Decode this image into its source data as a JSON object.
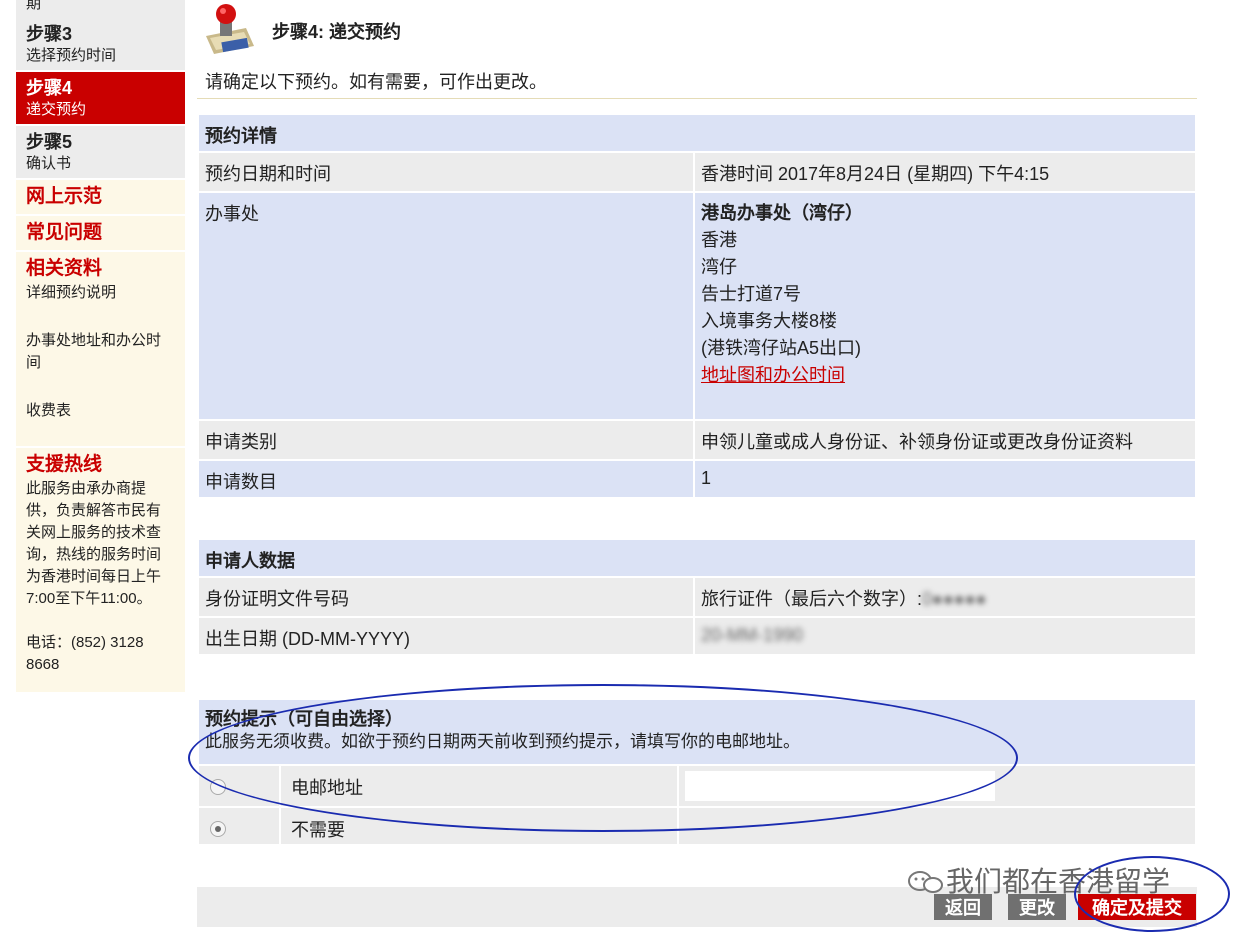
{
  "sidebar": {
    "top_fragment": "期",
    "steps": [
      {
        "title": "步骤3",
        "sub": "选择预约时间"
      },
      {
        "title": "步骤4",
        "sub": "递交预约"
      },
      {
        "title": "步骤5",
        "sub": "确认书"
      }
    ],
    "links": [
      {
        "title": "网上示范"
      },
      {
        "title": "常见问题"
      }
    ],
    "related": {
      "title": "相关资料",
      "items": [
        "详细预约说明",
        "办事处地址和办公时间",
        "收费表"
      ]
    },
    "hotline": {
      "title": "支援热线",
      "desc": "此服务由承办商提供，负责解答市民有关网上服务的技术查询，热线的服务时间为香港时间每日上午7:00至下午11:00。",
      "phone": "电话：(852) 3128 8668"
    }
  },
  "header": {
    "title": "步骤4: 递交预约",
    "intro": "请确定以下预约。如有需要，可作出更改。"
  },
  "details": {
    "heading": "预约详情",
    "datetime_label": "预约日期和时间",
    "datetime_value": "香港时间 2017年8月24日 (星期四) 下午4:15",
    "office_label": "办事处",
    "office_lines": [
      "港岛办事处（湾仔）",
      "香港",
      "湾仔",
      "告士打道7号",
      "入境事务大楼8楼",
      "(港铁湾仔站A5出口)"
    ],
    "map_link": "地址图和办公时间",
    "type_label": "申请类别",
    "type_value": "申领儿童或成人身份证、补领身份证或更改身份证资料",
    "count_label": "申请数目",
    "count_value": "1"
  },
  "applicant": {
    "heading": "申请人数据",
    "id_label": "身份证明文件号码",
    "id_value": "旅行证件（最后六个数字）:",
    "id_masked": "0●●●●●",
    "dob_label": "出生日期 (DD-MM-YYYY)",
    "dob_masked": "20-MM-1990"
  },
  "reminder": {
    "title": "预约提示（可自由选择）",
    "desc": "此服务无须收费。如欲于预约日期两天前收到预约提示，请填写你的电邮地址。",
    "options": [
      {
        "label": "电邮地址",
        "checked": false
      },
      {
        "label": "不需要",
        "checked": true
      }
    ],
    "email_value": ""
  },
  "buttons": {
    "back": "返回",
    "change": "更改",
    "confirm": "确定及提交"
  },
  "watermark": "我们都在香港留学",
  "colors": {
    "accent_red": "#c90000",
    "header_blue": "#dbe2f5",
    "grey_row": "#ececec",
    "sidebar_bg": "#fdf8e7",
    "annotation_blue": "#1a2bb0"
  }
}
